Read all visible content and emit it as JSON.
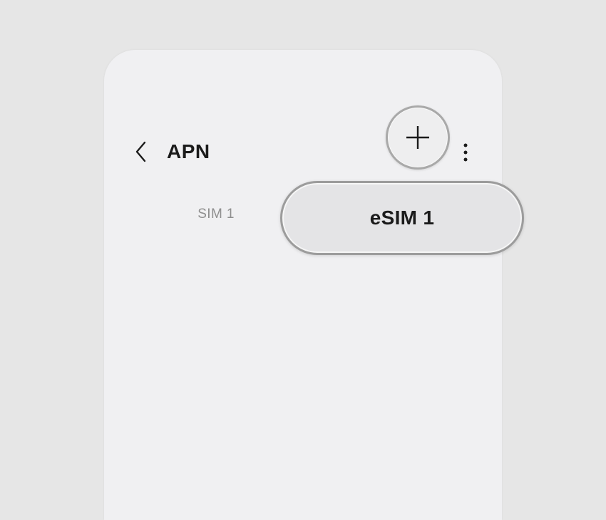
{
  "header": {
    "title": "APN",
    "back_icon": "chevron-left-icon",
    "add_icon": "plus-icon",
    "more_icon": "more-vertical-icon"
  },
  "tabs": [
    {
      "label": "SIM 1",
      "selected": false
    },
    {
      "label": "eSIM 1",
      "selected": true
    }
  ],
  "colors": {
    "page_background": "#e6e6e6",
    "screen_background": "#f0f0f2",
    "text_primary": "#1b1b1b",
    "text_secondary": "#8e8e8e",
    "highlight_border": "#9c9c9c"
  }
}
